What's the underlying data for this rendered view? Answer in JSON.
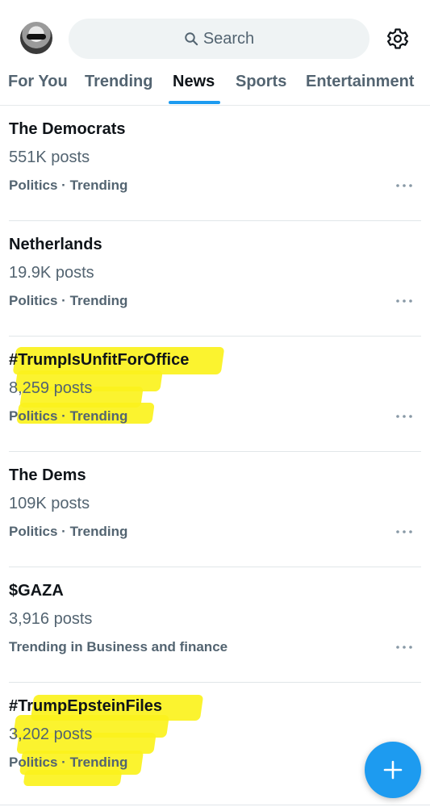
{
  "header": {
    "avatar_icon": "user-avatar",
    "search_placeholder": "Search",
    "search_icon": "search-icon",
    "settings_icon": "gear-icon"
  },
  "tabs": [
    {
      "label": "For You",
      "active": false
    },
    {
      "label": "Trending",
      "active": false
    },
    {
      "label": "News",
      "active": true
    },
    {
      "label": "Sports",
      "active": false
    },
    {
      "label": "Entertainment",
      "active": false
    }
  ],
  "trends": [
    {
      "title": "The Democrats",
      "count": "551K posts",
      "category": "Politics · Trending",
      "highlighted": false
    },
    {
      "title": "Netherlands",
      "count": "19.9K posts",
      "category": "Politics · Trending",
      "highlighted": false
    },
    {
      "title": "#TrumpIsUnfitForOffice",
      "count": "8,259 posts",
      "category": "Politics · Trending",
      "highlighted": true
    },
    {
      "title": "The Dems",
      "count": "109K posts",
      "category": "Politics · Trending",
      "highlighted": false
    },
    {
      "title": "$GAZA",
      "count": "3,916 posts",
      "category": "Trending in Business and finance",
      "highlighted": false
    },
    {
      "title": "#TrumpEpsteinFiles",
      "count": "3,202 posts",
      "category": "Politics · Trending",
      "highlighted": true
    }
  ],
  "fab": {
    "icon": "plus-icon"
  },
  "colors": {
    "accent": "#1d9bf0",
    "highlight": "#fbf21d",
    "secondary_text": "#536471"
  }
}
